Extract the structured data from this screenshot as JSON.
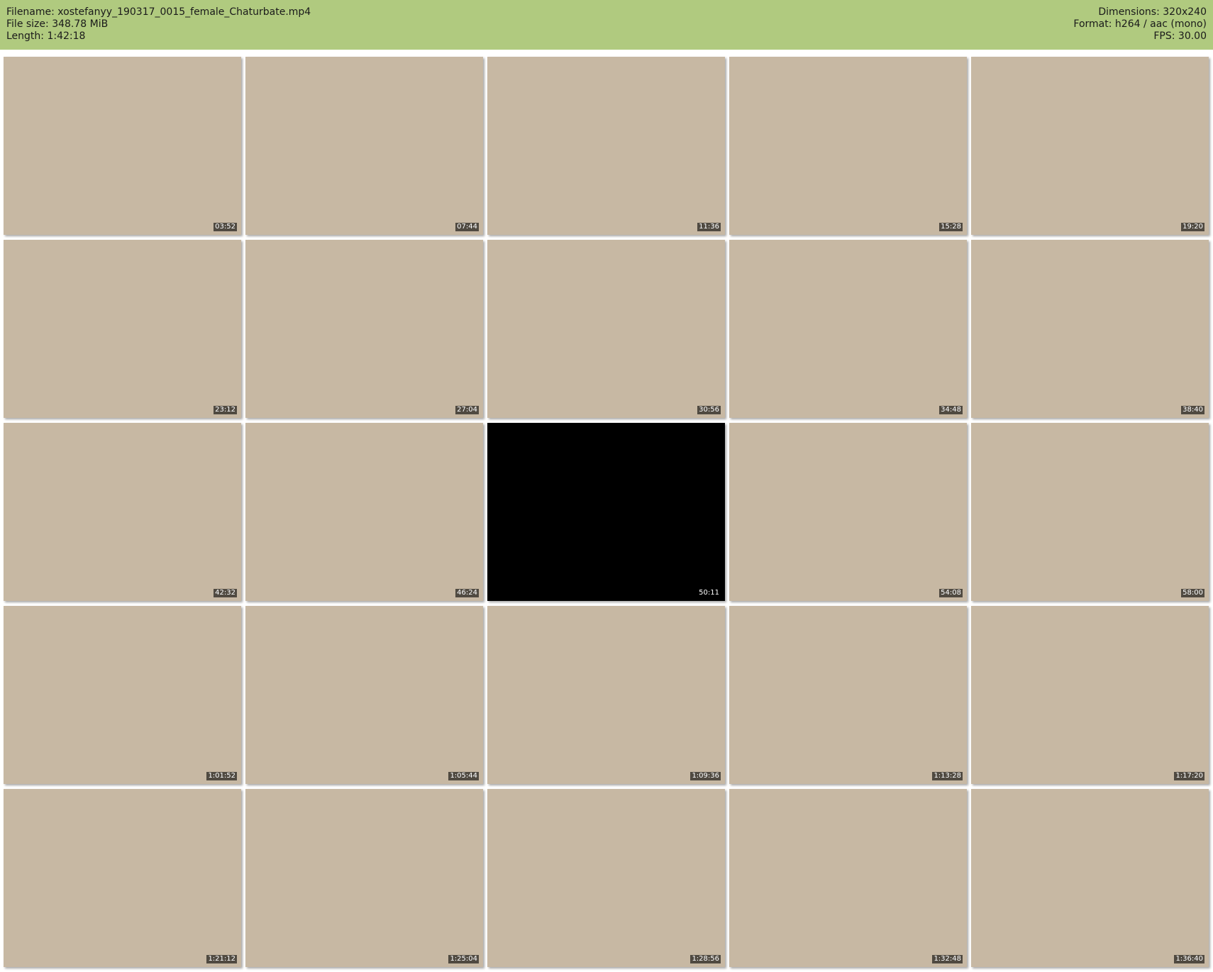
{
  "header": {
    "filename": "Filename: xostefanyy_190317_0015_female_Chaturbate.mp4",
    "filesize": "File size: 348.78 MiB",
    "length": "Length: 1:42:18",
    "dimensions": "Dimensions: 320x240",
    "format": "Format: h264 / aac (mono)",
    "fps": "FPS: 30.00"
  },
  "thumbnails": [
    {
      "time": "03:52"
    },
    {
      "time": "07:44"
    },
    {
      "time": "11:36"
    },
    {
      "time": "15:28"
    },
    {
      "time": "19:20"
    },
    {
      "time": "23:12"
    },
    {
      "time": "27:04"
    },
    {
      "time": "30:56"
    },
    {
      "time": "34:48"
    },
    {
      "time": "38:40"
    },
    {
      "time": "42:32"
    },
    {
      "time": "46:24"
    },
    {
      "time": "50:11",
      "dark": true
    },
    {
      "time": "54:08"
    },
    {
      "time": "58:00"
    },
    {
      "time": "1:01:52"
    },
    {
      "time": "1:05:44"
    },
    {
      "time": "1:09:36"
    },
    {
      "time": "1:13:28"
    },
    {
      "time": "1:17:20"
    },
    {
      "time": "1:21:12"
    },
    {
      "time": "1:25:04"
    },
    {
      "time": "1:28:56"
    },
    {
      "time": "1:32:48"
    },
    {
      "time": "1:36:40"
    }
  ]
}
